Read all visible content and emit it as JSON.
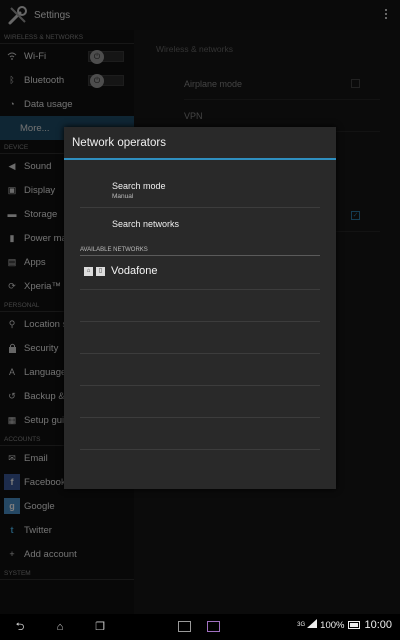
{
  "actionbar": {
    "title": "Settings"
  },
  "sidebar": {
    "sections": [
      "WIRELESS & NETWORKS",
      "DEVICE",
      "PERSONAL",
      "ACCOUNTS",
      "SYSTEM"
    ],
    "items": [
      {
        "label": "Wi-Fi",
        "icon": "wifi-icon",
        "glyph": "⌔"
      },
      {
        "label": "Bluetooth",
        "icon": "bluetooth-icon",
        "glyph": "ᛒ"
      },
      {
        "label": "Data usage",
        "icon": "data-usage-icon",
        "glyph": "◔"
      },
      {
        "label": "More...",
        "icon": "",
        "glyph": ""
      },
      {
        "label": "Sound",
        "icon": "sound-icon",
        "glyph": "◀"
      },
      {
        "label": "Display",
        "icon": "display-icon",
        "glyph": "▣"
      },
      {
        "label": "Storage",
        "icon": "storage-icon",
        "glyph": "▬"
      },
      {
        "label": "Power management",
        "icon": "power-icon",
        "glyph": "▮"
      },
      {
        "label": "Apps",
        "icon": "apps-icon",
        "glyph": "▤"
      },
      {
        "label": "Xperia™",
        "icon": "xperia-icon",
        "glyph": "⟳"
      },
      {
        "label": "Location services",
        "icon": "location-icon",
        "glyph": "⚲"
      },
      {
        "label": "Security",
        "icon": "security-icon",
        "glyph": "🔒"
      },
      {
        "label": "Language & input",
        "icon": "language-icon",
        "glyph": "A"
      },
      {
        "label": "Backup & reset",
        "icon": "backup-icon",
        "glyph": "↺"
      },
      {
        "label": "Setup guide",
        "icon": "setup-guide-icon",
        "glyph": "▦"
      },
      {
        "label": "Email",
        "icon": "email-icon",
        "glyph": "✉"
      },
      {
        "label": "Facebook",
        "icon": "facebook-icon",
        "glyph": "f"
      },
      {
        "label": "Google",
        "icon": "google-icon",
        "glyph": "g"
      },
      {
        "label": "Twitter",
        "icon": "twitter-icon",
        "glyph": "t"
      },
      {
        "label": "Add account",
        "icon": "add-icon",
        "glyph": "+"
      }
    ]
  },
  "detail": {
    "heading": "Wireless & networks",
    "rows": [
      "Airplane mode",
      "VPN"
    ]
  },
  "dialog": {
    "title": "Network operators",
    "search_mode": {
      "label": "Search mode",
      "value": "Manual"
    },
    "search_networks": "Search networks",
    "available_header": "AVAILABLE NETWORKS",
    "networks": [
      {
        "name": "Vodafone"
      }
    ]
  },
  "status": {
    "network": "3G",
    "battery": "100%",
    "time": "10:00"
  },
  "colors": {
    "accent": "#2f8fc0",
    "selected": "#1f4c68"
  }
}
